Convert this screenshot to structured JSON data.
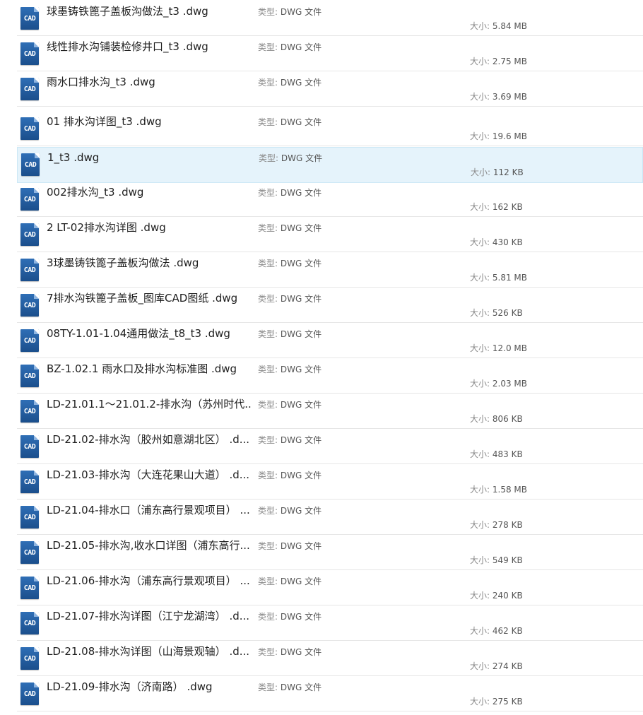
{
  "files": [
    {
      "name": "球墨铸铁篦子盖板沟做法_t3  .dwg",
      "type_key": "类型:",
      "type": "DWG 文件",
      "size_key": "大小:",
      "size": "5.84 MB",
      "icon": "cad-file-icon"
    },
    {
      "name": "线性排水沟铺装检修井口_t3  .dwg",
      "type_key": "类型:",
      "type": "DWG 文件",
      "size_key": "大小:",
      "size": "2.75 MB",
      "icon": "cad-file-icon"
    },
    {
      "name": "雨水口排水沟_t3  .dwg",
      "type_key": "类型:",
      "type": "DWG 文件",
      "size_key": "大小:",
      "size": "3.69 MB",
      "icon": "cad-file-icon"
    },
    {
      "name": "01 排水沟详图_t3  .dwg",
      "type_key": "类型:",
      "type": "DWG 文件",
      "size_key": "大小:",
      "size": "19.6 MB",
      "icon": "cad-file-icon"
    },
    {
      "name": "1_t3  .dwg",
      "type_key": "类型:",
      "type": "DWG 文件",
      "size_key": "大小:",
      "size": "112 KB",
      "icon": "cad-file-icon",
      "selected": true
    },
    {
      "name": "002排水沟_t3  .dwg",
      "type_key": "类型:",
      "type": "DWG 文件",
      "size_key": "大小:",
      "size": "162 KB",
      "icon": "cad-file-icon"
    },
    {
      "name": "2 LT-02排水沟详图  .dwg",
      "type_key": "类型:",
      "type": "DWG 文件",
      "size_key": "大小:",
      "size": "430 KB",
      "icon": "cad-file-icon"
    },
    {
      "name": "3球墨铸铁篦子盖板沟做法  .dwg",
      "type_key": "类型:",
      "type": "DWG 文件",
      "size_key": "大小:",
      "size": "5.81 MB",
      "icon": "cad-file-icon"
    },
    {
      "name": "7排水沟铁篦子盖板_图库CAD图纸  .dwg",
      "type_key": "类型:",
      "type": "DWG 文件",
      "size_key": "大小:",
      "size": "526 KB",
      "icon": "cad-file-icon"
    },
    {
      "name": "08TY-1.01-1.04通用做法_t8_t3  .dwg",
      "type_key": "类型:",
      "type": "DWG 文件",
      "size_key": "大小:",
      "size": "12.0 MB",
      "icon": "cad-file-icon"
    },
    {
      "name": "BZ-1.02.1 雨水口及排水沟标准图  .dwg",
      "type_key": "类型:",
      "type": "DWG 文件",
      "size_key": "大小:",
      "size": "2.03 MB",
      "icon": "cad-file-icon"
    },
    {
      "name": "LD-21.01.1～21.01.2-排水沟（苏州时代...",
      "type_key": "类型:",
      "type": "DWG 文件",
      "size_key": "大小:",
      "size": "806 KB",
      "icon": "cad-file-icon"
    },
    {
      "name": "LD-21.02-排水沟（胶州如意湖北区）  .d...",
      "type_key": "类型:",
      "type": "DWG 文件",
      "size_key": "大小:",
      "size": "483 KB",
      "icon": "cad-file-icon"
    },
    {
      "name": "LD-21.03-排水沟（大连花果山大道）  .d...",
      "type_key": "类型:",
      "type": "DWG 文件",
      "size_key": "大小:",
      "size": "1.58 MB",
      "icon": "cad-file-icon"
    },
    {
      "name": "LD-21.04-排水口（浦东高行景观项目）  ...",
      "type_key": "类型:",
      "type": "DWG 文件",
      "size_key": "大小:",
      "size": "278 KB",
      "icon": "cad-file-icon"
    },
    {
      "name": "LD-21.05-排水沟,收水口详图（浦东高行...",
      "type_key": "类型:",
      "type": "DWG 文件",
      "size_key": "大小:",
      "size": "549 KB",
      "icon": "cad-file-icon"
    },
    {
      "name": "LD-21.06-排水沟（浦东高行景观项目）  ...",
      "type_key": "类型:",
      "type": "DWG 文件",
      "size_key": "大小:",
      "size": "240 KB",
      "icon": "cad-file-icon"
    },
    {
      "name": "LD-21.07-排水沟详图（江宁龙湖湾）  .d...",
      "type_key": "类型:",
      "type": "DWG 文件",
      "size_key": "大小:",
      "size": "462 KB",
      "icon": "cad-file-icon"
    },
    {
      "name": "LD-21.08-排水沟详图（山海景观轴）  .d...",
      "type_key": "类型:",
      "type": "DWG 文件",
      "size_key": "大小:",
      "size": "274 KB",
      "icon": "cad-file-icon"
    },
    {
      "name": "LD-21.09-排水沟（济南路）  .dwg",
      "type_key": "类型:",
      "type": "DWG 文件",
      "size_key": "大小:",
      "size": "275 KB",
      "icon": "cad-file-icon"
    }
  ],
  "icon_text": "CAD",
  "colors": {
    "selection_bg": "#e5f3fb",
    "selection_border": "#cce8f6",
    "icon_blue": "#2f6fb6"
  }
}
